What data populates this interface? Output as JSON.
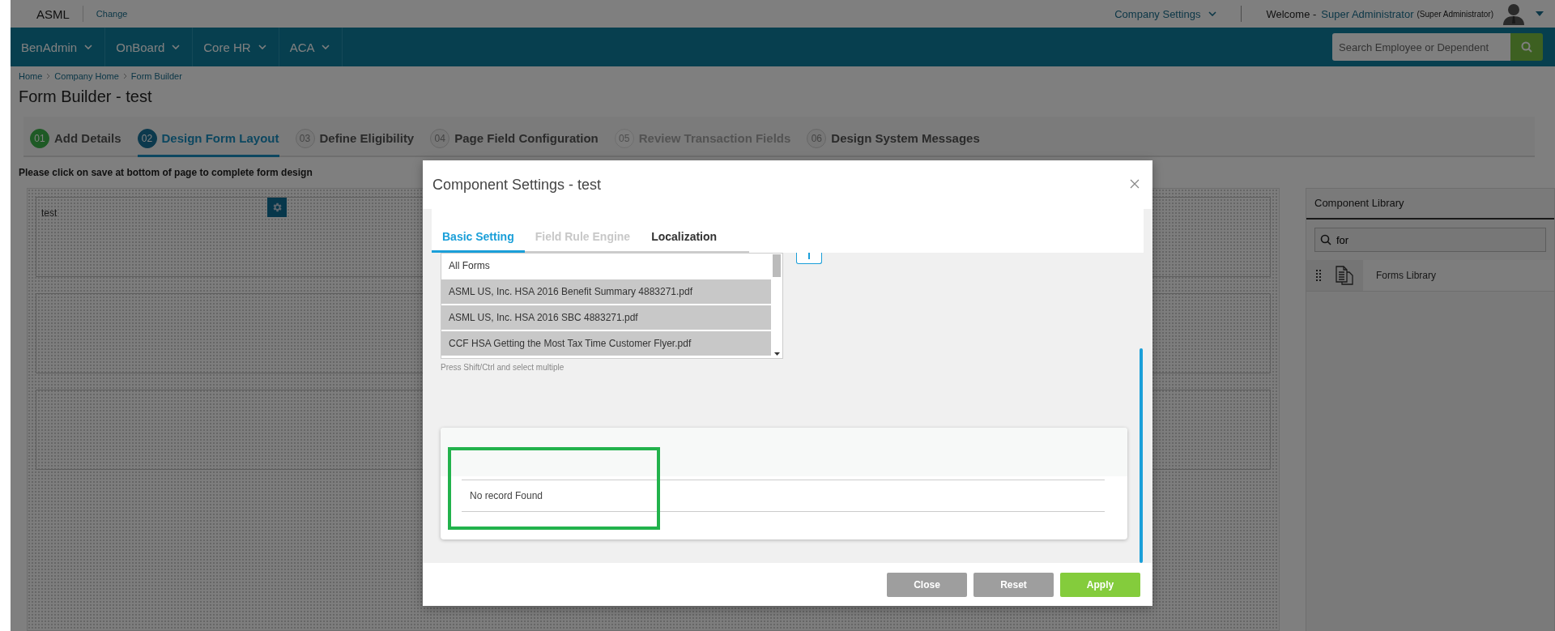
{
  "top_bar": {
    "company": "ASML",
    "change_link": "Change",
    "company_settings": "Company Settings",
    "welcome": "Welcome -",
    "user_name": "Super Administrator",
    "user_role": "(Super Administrator)"
  },
  "nav": {
    "items": [
      {
        "label": "BenAdmin"
      },
      {
        "label": "OnBoard"
      },
      {
        "label": "Core HR"
      },
      {
        "label": "ACA"
      }
    ],
    "search": {
      "placeholder": "Search Employee or Dependent"
    }
  },
  "breadcrumb": [
    {
      "label": "Home"
    },
    {
      "label": "Company Home"
    },
    {
      "label": "Form Builder"
    }
  ],
  "page_title": "Form Builder - test",
  "steps": [
    {
      "number": "01",
      "label": "Add Details",
      "completed": true,
      "disabled": false,
      "selected": false
    },
    {
      "number": "02",
      "label": "Design Form Layout",
      "completed": false,
      "disabled": false,
      "selected": true
    },
    {
      "number": "03",
      "label": "Define Eligibility",
      "completed": false,
      "disabled": false,
      "selected": false
    },
    {
      "number": "04",
      "label": "Page Field Configuration",
      "completed": false,
      "disabled": false,
      "selected": false
    },
    {
      "number": "05",
      "label": "Review Transaction Fields",
      "completed": false,
      "disabled": true,
      "selected": false
    },
    {
      "number": "06",
      "label": "Design System Messages",
      "completed": false,
      "disabled": false,
      "selected": false
    }
  ],
  "note": "Please click on save at bottom of page to complete form design",
  "canvas": {
    "sections": [
      {
        "label": "test",
        "has_settings": true
      },
      {
        "has_settings": false
      },
      {
        "has_settings": false
      }
    ]
  },
  "component_library": {
    "title": "Component Library",
    "search": {
      "value": "for"
    },
    "items": [
      {
        "label": "Forms Library"
      }
    ]
  },
  "modal": {
    "title": "Component Settings - test",
    "tabs": [
      {
        "label": "Basic Setting",
        "selected": true,
        "disabled": false
      },
      {
        "label": "Field Rule Engine",
        "selected": false,
        "disabled": true
      },
      {
        "label": "Localization",
        "selected": false,
        "disabled": false
      }
    ],
    "forms_list": {
      "items": [
        {
          "label": "All Forms",
          "selected": false
        },
        {
          "label": "ASML US, Inc. HSA 2016 Benefit Summary 4883271.pdf",
          "selected": true
        },
        {
          "label": "ASML US, Inc. HSA 2016 SBC 4883271.pdf",
          "selected": true
        },
        {
          "label": "CCF HSA Getting the Most Tax Time Customer Flyer.pdf",
          "selected": true
        }
      ]
    },
    "hint": "Press Shift/Ctrl and select multiple",
    "table": {
      "empty_message": "No record Found"
    },
    "buttons": [
      {
        "label": "Close",
        "kind": "secondary"
      },
      {
        "label": "Reset",
        "kind": "secondary"
      },
      {
        "label": "Apply",
        "kind": "primary"
      }
    ]
  }
}
